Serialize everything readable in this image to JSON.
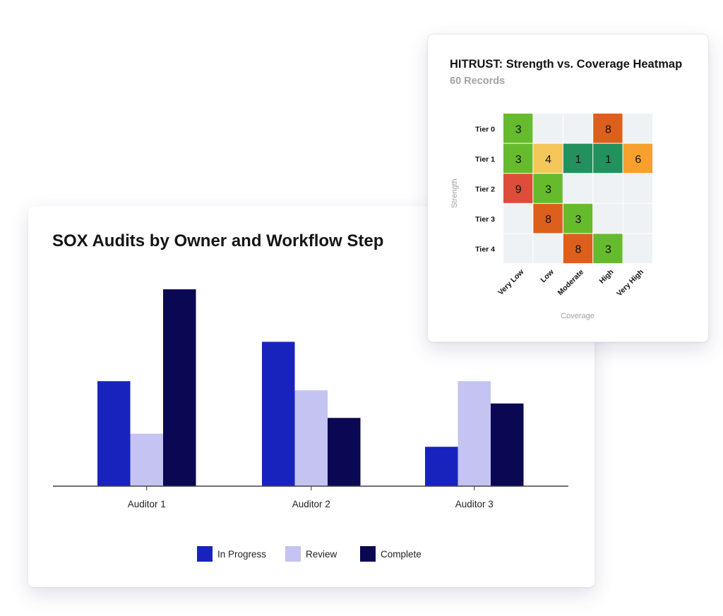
{
  "chart_data": [
    {
      "type": "bar",
      "title": "SOX Audits by Owner and Workflow Step",
      "categories": [
        "Auditor 1",
        "Auditor 2",
        "Auditor 3"
      ],
      "series": [
        {
          "name": "In Progress",
          "color": "#1823be",
          "values": [
            8,
            11,
            3
          ]
        },
        {
          "name": "Review",
          "color": "#c4c3f1",
          "values": [
            4,
            7.3,
            8
          ]
        },
        {
          "name": "Complete",
          "color": "#0a0852",
          "values": [
            15,
            5.2,
            6.3
          ]
        }
      ],
      "ylim": [
        0,
        15
      ],
      "y_axis_shown": false,
      "grid": false,
      "legend_position": "bottom"
    },
    {
      "type": "heatmap",
      "title": "HITRUST: Strength vs. Coverage Heatmap",
      "subtitle": "60 Records",
      "xlabel": "Coverage",
      "ylabel": "Strength",
      "x_categories": [
        "Very Low",
        "Low",
        "Moderate",
        "High",
        "Very High"
      ],
      "y_categories": [
        "Tier 0",
        "Tier 1",
        "Tier 2",
        "Tier 3",
        "Tier 4"
      ],
      "values": [
        [
          3,
          null,
          null,
          8,
          null
        ],
        [
          3,
          4,
          1,
          1,
          6
        ],
        [
          9,
          3,
          null,
          null,
          null
        ],
        [
          null,
          8,
          3,
          null,
          null
        ],
        [
          null,
          null,
          8,
          3,
          null
        ]
      ],
      "cell_colors": [
        [
          "#66bb2c",
          null,
          null,
          "#dd5f1c",
          null
        ],
        [
          "#66bb2c",
          "#f5c65a",
          "#22915e",
          "#22915e",
          "#f8a02e"
        ],
        [
          "#de4c3a",
          "#66bb2c",
          null,
          null,
          null
        ],
        [
          null,
          "#dd5f1c",
          "#66bb2c",
          null,
          null
        ],
        [
          null,
          null,
          "#dd5f1c",
          "#66bb2c",
          null
        ]
      ],
      "empty_color": "#eff2f4"
    }
  ]
}
